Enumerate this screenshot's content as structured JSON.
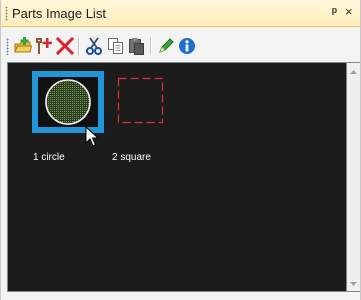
{
  "panel": {
    "title": "Parts Image List",
    "pin_icon": "pin-icon",
    "close_icon": "close-icon",
    "pin_glyph": "ᵖ",
    "close_glyph": "×"
  },
  "toolbar": {
    "buttons": [
      {
        "name": "add-part-button",
        "icon": "add-folder-icon"
      },
      {
        "name": "add-point-button",
        "icon": "add-point-icon"
      },
      {
        "name": "delete-button",
        "icon": "red-x-icon"
      },
      {
        "name": "cut-button",
        "icon": "scissors-icon"
      },
      {
        "name": "copy-button",
        "icon": "copy-icon"
      },
      {
        "name": "paste-button",
        "icon": "paste-icon"
      },
      {
        "name": "edit-button",
        "icon": "pencil-icon"
      },
      {
        "name": "info-button",
        "icon": "info-icon"
      }
    ]
  },
  "parts": [
    {
      "label": "1 circle",
      "shape": "circle",
      "selected": true
    },
    {
      "label": "2 square",
      "shape": "square",
      "selected": false
    }
  ],
  "colors": {
    "selection": "#2196d9",
    "list_background": "#1c1c1c",
    "square_outline": "#e0303a",
    "circle_outline": "#f0f0f0"
  }
}
